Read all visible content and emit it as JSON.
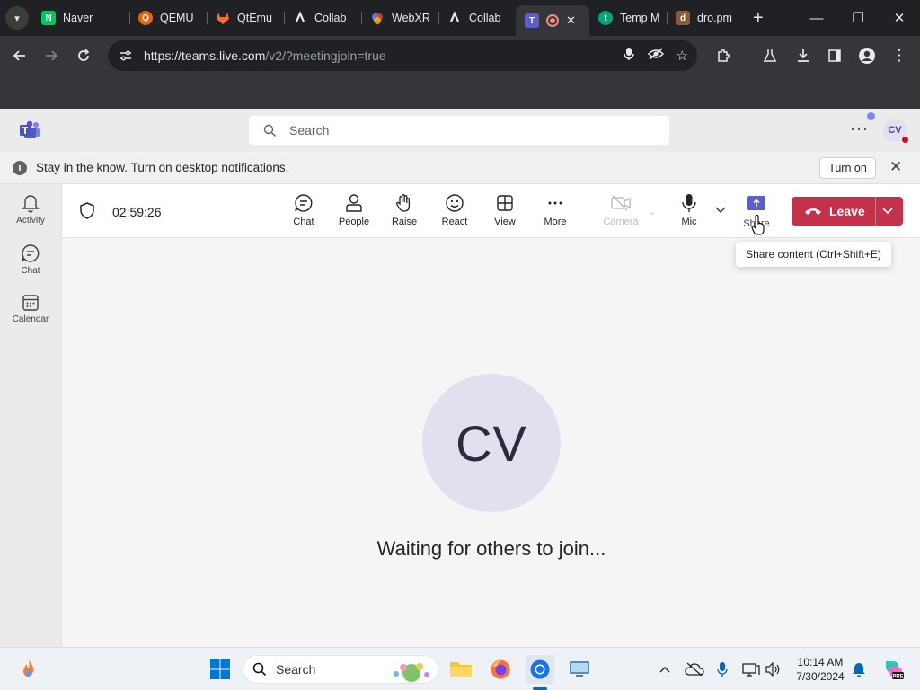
{
  "browser": {
    "tabs": [
      {
        "title": "Naver",
        "icon": "naver-icon",
        "color": "#03c75a"
      },
      {
        "title": "QEMU",
        "icon": "qemu-icon",
        "color": "#ff6600"
      },
      {
        "title": "QtEmu",
        "icon": "gitlab-icon",
        "color": "#fc6d26"
      },
      {
        "title": "Collab",
        "icon": "collab-icon",
        "color": "#9aa0a6"
      },
      {
        "title": "WebXR",
        "icon": "webxr-icon",
        "color": "#4285f4"
      },
      {
        "title": "Collab",
        "icon": "collab-icon",
        "color": "#9aa0a6"
      },
      {
        "title": "",
        "icon": "teams-icon",
        "color": "#5b5fc7",
        "active": true
      },
      {
        "title": "Temp M",
        "icon": "temp-icon",
        "color": "#00a67e"
      },
      {
        "title": "dro.pm",
        "icon": "drop-icon",
        "color": "#8a5a3c"
      }
    ],
    "url_main": "https://teams.live.com",
    "url_rest": "/v2/?meetingjoin=true"
  },
  "teams": {
    "search_placeholder": "Search",
    "avatar_initials": "CV",
    "notification_text": "Stay in the know. Turn on desktop notifications.",
    "turn_on_label": "Turn on",
    "rail": [
      {
        "label": "Activity"
      },
      {
        "label": "Chat"
      },
      {
        "label": "Calendar"
      }
    ],
    "meeting": {
      "timer": "02:59:26",
      "controls": {
        "chat": "Chat",
        "people": "People",
        "raise": "Raise",
        "react": "React",
        "view": "View",
        "more": "More",
        "camera": "Camera",
        "mic": "Mic",
        "share": "Share"
      },
      "leave_label": "Leave",
      "tooltip": "Share content (Ctrl+Shift+E)",
      "participant_initials": "CV",
      "waiting_text": "Waiting for others to join..."
    }
  },
  "taskbar": {
    "search_placeholder": "Search",
    "time": "10:14 AM",
    "date": "7/30/2024"
  },
  "colors": {
    "accent": "#5b5fc7",
    "leave": "#c4314b"
  }
}
